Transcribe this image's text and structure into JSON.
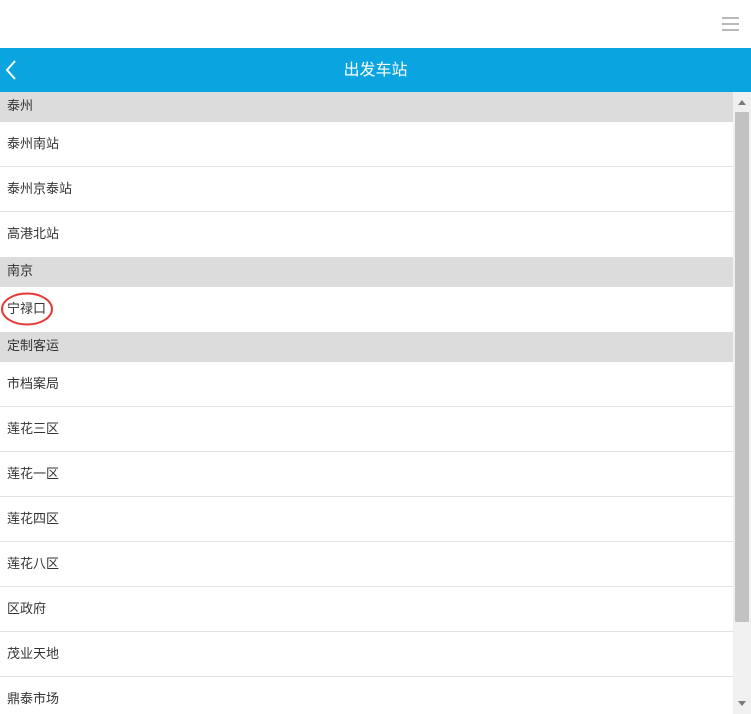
{
  "header": {
    "title": "出发车站",
    "back_icon": "chevron-left-icon",
    "menu_icon": "hamburger-menu-icon",
    "nav_color": "#0aa5e0"
  },
  "groups": [
    {
      "name": "泰州",
      "stations": [
        "泰州南站",
        "泰州京泰站",
        "高港北站"
      ]
    },
    {
      "name": "南京",
      "stations": [
        "宁禄口"
      ]
    },
    {
      "name": "定制客运",
      "stations": [
        "市档案局",
        "莲花三区",
        "莲花一区",
        "莲花四区",
        "莲花八区",
        "区政府",
        "茂业天地",
        "鼎泰市场"
      ]
    }
  ],
  "annotation": {
    "highlight_color": "#e53935"
  }
}
